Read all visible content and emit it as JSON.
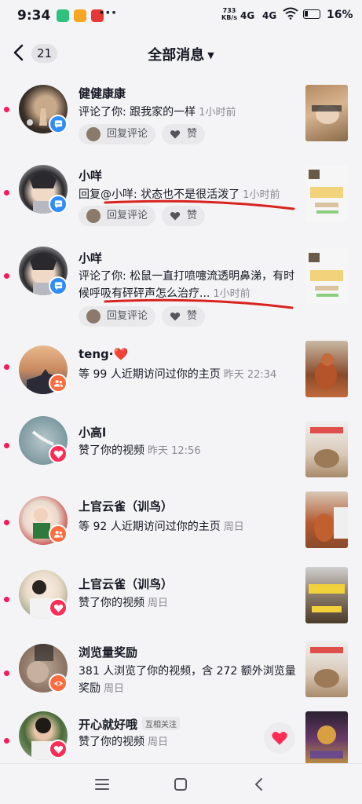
{
  "status_bar": {
    "time": "9:34",
    "net_speed_value": "733",
    "net_speed_unit": "KB/s",
    "signal_1": "4G",
    "signal_2": "4G",
    "battery": "16%"
  },
  "header": {
    "back_label": "<",
    "unread_count": "21",
    "title": "全部消息"
  },
  "messages": [
    {
      "name": "健健康康",
      "text": "评论了你: 跟我家的一样",
      "time": "1小时前",
      "reply_label": "回复评论",
      "like_label": "赞",
      "badge_icon": "comment-icon"
    },
    {
      "name": "小咩",
      "text": "回复@小咩: 状态也不是很活泼了",
      "time": "1小时前",
      "reply_label": "回复评论",
      "like_label": "赞",
      "badge_icon": "comment-icon"
    },
    {
      "name": "小咩",
      "text": "评论了你: 松鼠一直打喷嚏流透明鼻涕，有时候呼吸有砰砰声怎么治疗...",
      "time": "1小时前",
      "reply_label": "回复评论",
      "like_label": "赞",
      "badge_icon": "comment-icon"
    },
    {
      "name": "teng·",
      "name_emoji": "❤️",
      "text": "等 99 人近期访问过你的主页",
      "time": "昨天 22:34",
      "badge_icon": "visitors-icon"
    },
    {
      "name": "小高l",
      "text": "赞了你的视频",
      "time": "昨天 12:56",
      "badge_icon": "heart-icon"
    },
    {
      "name": "上官云雀（训鸟）",
      "text": "等 92 人近期访问过你的主页",
      "time": "周日",
      "badge_icon": "visitors-icon"
    },
    {
      "name": "上官云雀（训鸟）",
      "text": "赞了你的视频",
      "time": "周日",
      "badge_icon": "heart-icon"
    },
    {
      "name": "浏览量奖励",
      "text": "381 人浏览了你的视频，含 272 额外浏览量奖励",
      "time": "周日",
      "badge_icon": "eye-icon"
    },
    {
      "name": "开心就好哦",
      "tag": "互相关注",
      "text": "赞了你的视频",
      "time": "周日",
      "badge_icon": "heart-icon"
    }
  ],
  "colors": {
    "unread_dot": "#f5195e",
    "comment_badge": "#2f8cf8",
    "visitor_badge": "#fe6b3e",
    "like_badge": "#fe2c55",
    "annotation": "#d8231e"
  }
}
